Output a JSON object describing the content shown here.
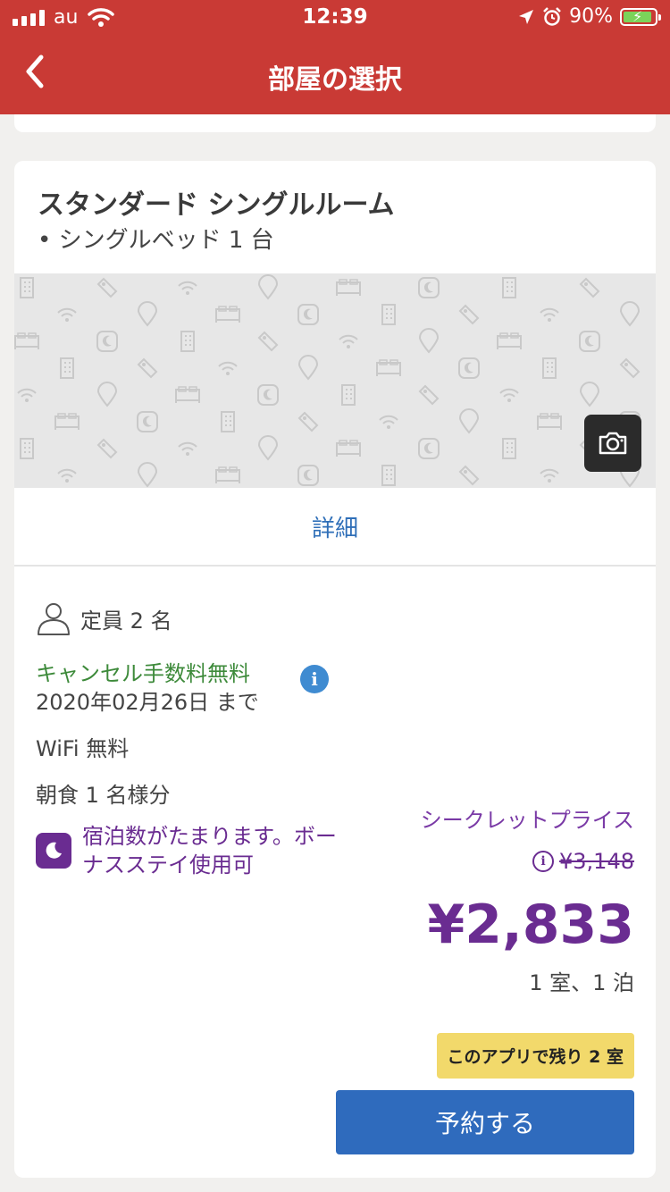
{
  "status_bar": {
    "carrier": "au",
    "time": "12:39",
    "battery": "90%"
  },
  "header": {
    "title": "部屋の選択"
  },
  "room": {
    "name": "スタンダード シングルルーム",
    "bed": "• シングルベッド 1 台",
    "details_link": "詳細"
  },
  "amenities": {
    "capacity": "定員 2 名",
    "cancellation": "キャンセル手数料無料",
    "cancellation_date": "2020年02月26日 まで",
    "wifi": "WiFi 無料",
    "breakfast": "朝食 1 名様分",
    "bonus_line1": "宿泊数がたまります。ボー",
    "bonus_line2": "ナスステイ使用可"
  },
  "pricing": {
    "label": "シークレットプライス",
    "original_price": "¥3,148",
    "price": "¥2,833",
    "unit": "1 室、1 泊",
    "rooms_left": "このアプリで残り 2 室",
    "reserve_button": "予約する"
  },
  "colors": {
    "header": "#c93a35",
    "secret_purple": "#6a2c91",
    "link_blue": "#2f6fb8",
    "button_blue": "#2f6bbd",
    "cancel_green": "#3d8a3a",
    "badge_yellow": "#f2d96b"
  }
}
